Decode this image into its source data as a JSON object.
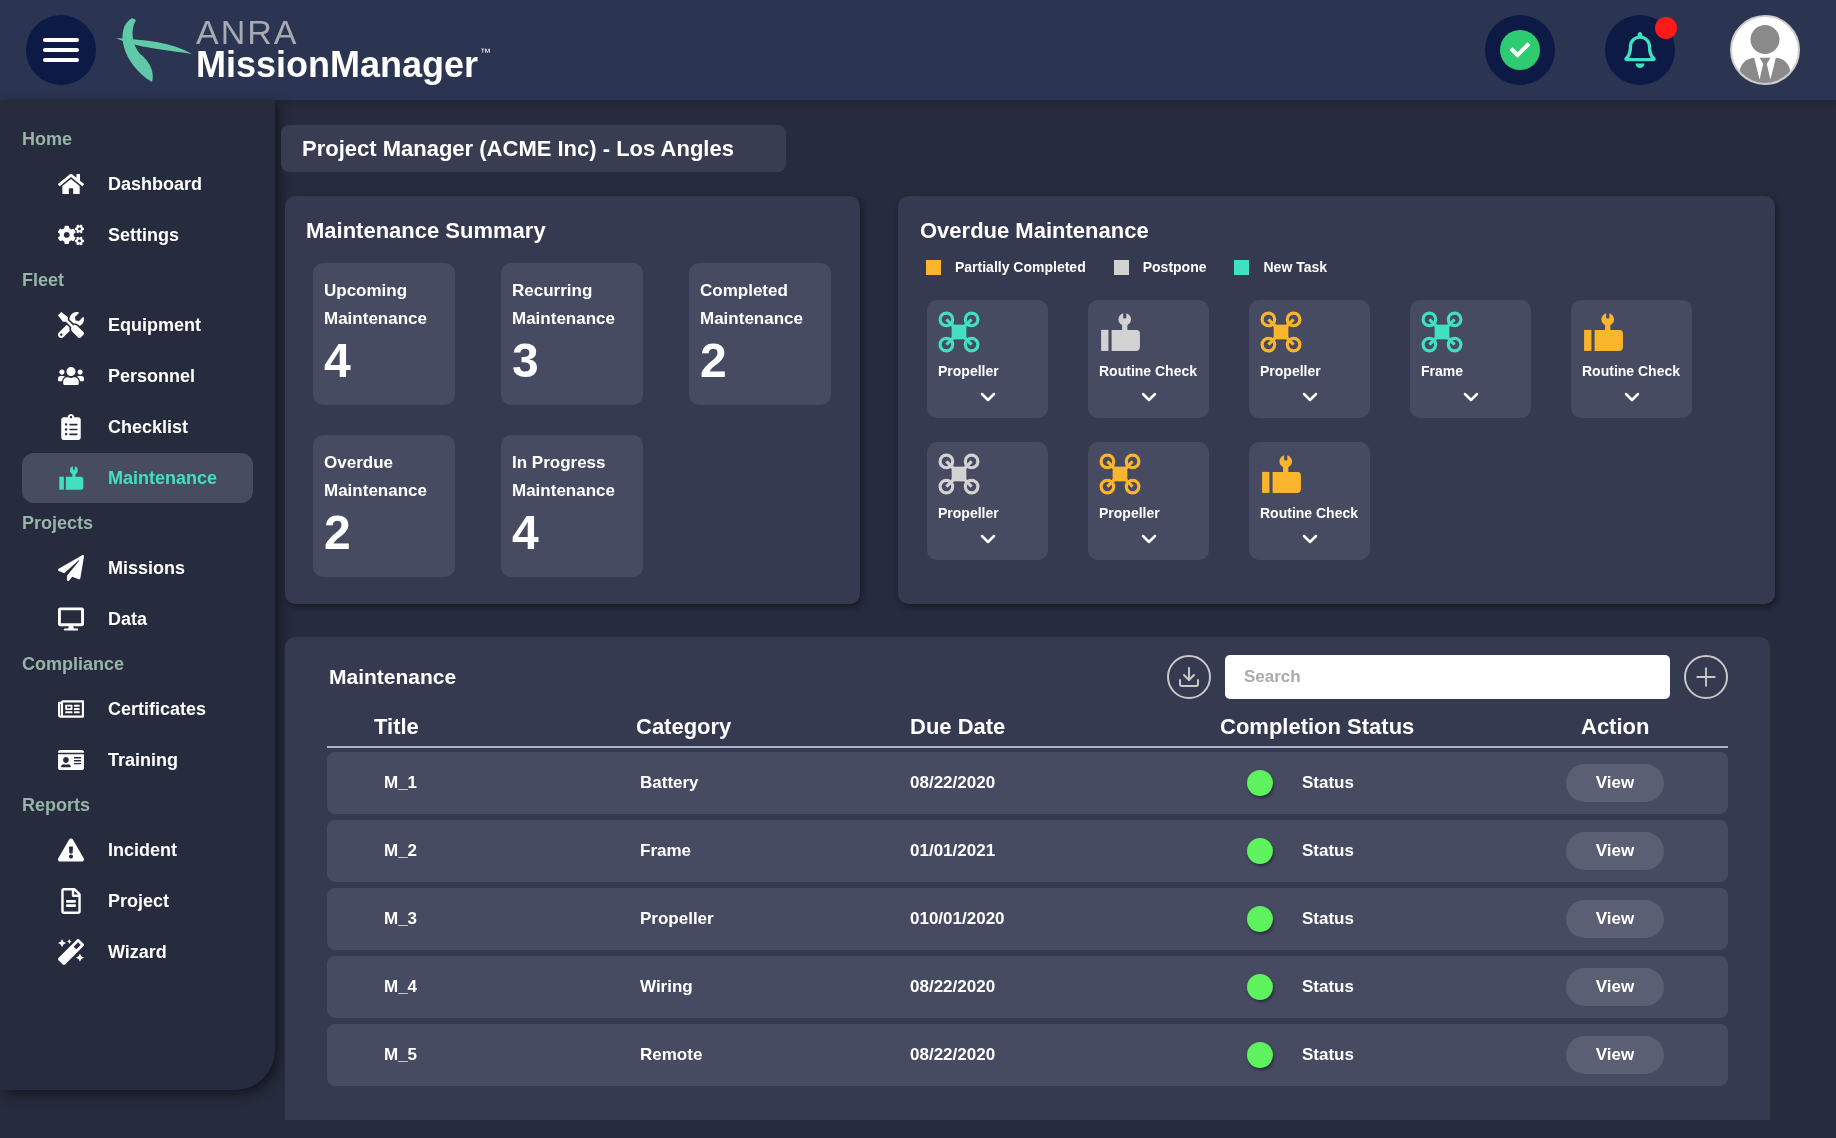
{
  "header": {
    "logo": {
      "brand": "ANRA",
      "product": "MissionManager",
      "trademark": "™"
    },
    "notifications": {
      "unread": true
    }
  },
  "sidebar": {
    "sections": [
      {
        "label": "Home",
        "items": [
          {
            "label": "Dashboard",
            "selected": false
          },
          {
            "label": "Settings",
            "selected": false
          }
        ]
      },
      {
        "label": "Fleet",
        "items": [
          {
            "label": "Equipment",
            "selected": false
          },
          {
            "label": "Personnel",
            "selected": false
          },
          {
            "label": "Checklist",
            "selected": false
          },
          {
            "label": "Maintenance",
            "selected": true
          }
        ]
      },
      {
        "label": "Projects",
        "items": [
          {
            "label": "Missions",
            "selected": false
          },
          {
            "label": "Data",
            "selected": false
          }
        ]
      },
      {
        "label": "Compliance",
        "items": [
          {
            "label": "Certificates",
            "selected": false
          },
          {
            "label": "Training",
            "selected": false
          }
        ]
      },
      {
        "label": "Reports",
        "items": [
          {
            "label": "Incident",
            "selected": false
          },
          {
            "label": "Project",
            "selected": false
          },
          {
            "label": "Wizard",
            "selected": false
          }
        ]
      }
    ]
  },
  "page_title": "Project Manager (ACME Inc) - Los Angles",
  "summary": {
    "title": "Maintenance Summary",
    "cards": [
      {
        "label": "Upcoming Maintenance",
        "count": "4"
      },
      {
        "label": "Recurring Maintenance",
        "count": "3"
      },
      {
        "label": "Completed Maintenance",
        "count": "2"
      },
      {
        "label": "Overdue Maintenance",
        "count": "2"
      },
      {
        "label": "In Progress Maintenance",
        "count": "4"
      }
    ]
  },
  "overdue": {
    "title": "Overdue Maintenance",
    "legend": [
      {
        "label": "Partially Completed",
        "color": "#fbb52d"
      },
      {
        "label": "Postpone",
        "color": "#d2d2d2"
      },
      {
        "label": "New Task",
        "color": "#40e0c0"
      }
    ],
    "items": [
      {
        "label": "Propeller",
        "kind": "drone",
        "color": "#40e0c0"
      },
      {
        "label": "Routine Check",
        "kind": "check",
        "color": "#d2d2d2"
      },
      {
        "label": "Propeller",
        "kind": "drone",
        "color": "#fbb52d"
      },
      {
        "label": "Frame",
        "kind": "drone",
        "color": "#40e0c0"
      },
      {
        "label": "Routine Check",
        "kind": "check",
        "color": "#fbb52d"
      },
      {
        "label": "Propeller",
        "kind": "drone",
        "color": "#d2d2d2"
      },
      {
        "label": "Propeller",
        "kind": "drone",
        "color": "#fbb52d"
      },
      {
        "label": "Routine Check",
        "kind": "check",
        "color": "#fbb52d"
      }
    ]
  },
  "table": {
    "title": "Maintenance",
    "search": {
      "placeholder": "Search"
    },
    "columns": [
      "Title",
      "Category",
      "Due Date",
      "Completion Status",
      "Action"
    ],
    "rows": [
      {
        "title": "M_1",
        "category": "Battery",
        "due_date": "08/22/2020",
        "status": "Status",
        "color": "#5ef25e",
        "action": "View"
      },
      {
        "title": "M_2",
        "category": "Frame",
        "due_date": "01/01/2021",
        "status": "Status",
        "color": "#5ef25e",
        "action": "View"
      },
      {
        "title": "M_3",
        "category": "Propeller",
        "due_date": "010/01/2020",
        "status": "Status",
        "color": "#5ef25e",
        "action": "View"
      },
      {
        "title": "M_4",
        "category": "Wiring",
        "due_date": "08/22/2020",
        "status": "Status",
        "color": "#5ef25e",
        "action": "View"
      },
      {
        "title": "M_5",
        "category": "Remote",
        "due_date": "08/22/2020",
        "status": "Status",
        "color": "#5ef25e",
        "action": "View"
      }
    ]
  }
}
